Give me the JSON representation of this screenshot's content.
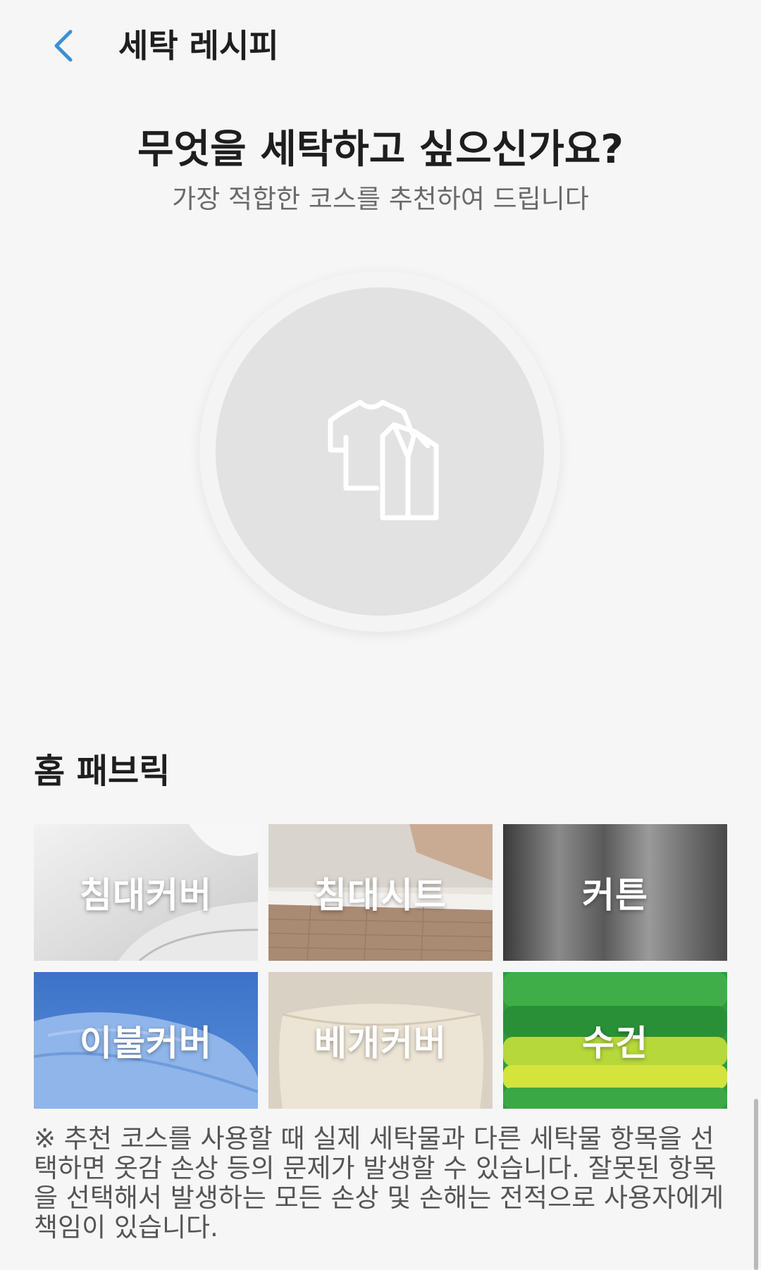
{
  "header": {
    "title": "세탁 레시피",
    "back_icon": "chevron-left-icon",
    "accent": "#3a8fd6"
  },
  "main": {
    "question": "무엇을 세탁하고 싶으신가요?",
    "subtitle": "가장 적합한 코스를 추천하여 드립니다",
    "selection_icon": "clothes-shirts-icon"
  },
  "section": {
    "title": "홈 패브릭",
    "items": [
      {
        "label": "침대커버",
        "color": "#e4e4e4"
      },
      {
        "label": "침대시트",
        "color": "#b89a82"
      },
      {
        "label": "커튼",
        "color": "#6e6e6e"
      },
      {
        "label": "이불커버",
        "color": "#6f9fdc"
      },
      {
        "label": "베개커버",
        "color": "#d6cdbd"
      },
      {
        "label": "수건",
        "color": "#46a84a"
      }
    ]
  },
  "notice": "※ 추천 코스를 사용할 때 실제 세탁물과 다른 세탁물 항목을 선택하면 옷감 손상 등의 문제가 발생할 수 있습니다. 잘못된 항목을 선택해서 발생하는 모든 손상 및 손해는 전적으로 사용자에게 책임이 있습니다."
}
